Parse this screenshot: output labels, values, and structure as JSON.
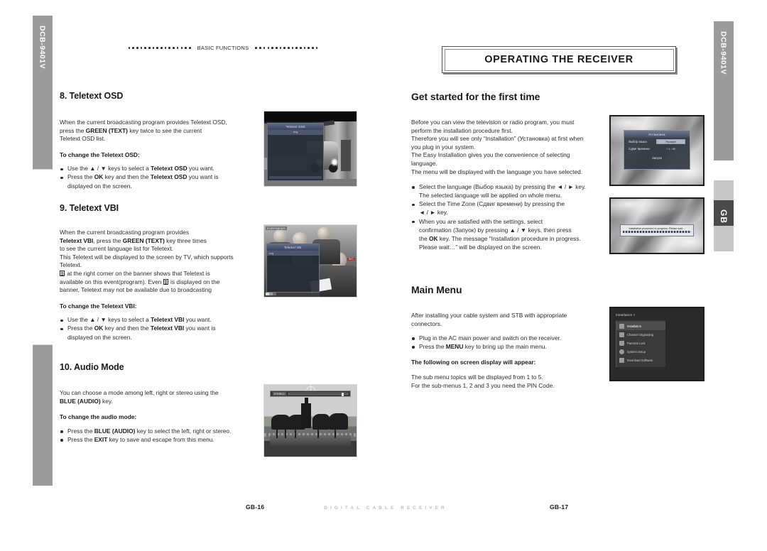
{
  "document": {
    "model": "DCB-9401V",
    "language_tab": "GB",
    "running_head": "BASIC FUNCTIONS",
    "running_head_dots": 16,
    "footer_brand": "DIGITAL CABLE RECEIVER"
  },
  "left_page": {
    "page_number": "GB-16",
    "sections": [
      {
        "heading": "8. Teletext OSD",
        "paragraph": "When the current broadcasting program provides Teletext OSD, press the GREEN (TEXT) key twice to see the current Teletext OSD list.",
        "para_parts": {
          "p1": "When the current broadcasting program provides Teletext OSD,",
          "p2a": "press the ",
          "p2b": "GREEN (TEXT)",
          "p2c": " key twice to see the current",
          "p3": "Teletext OSD list."
        },
        "sub_heading": "To change the Teletext OSD:",
        "bullets": [
          {
            "a": "Use the ▲ / ▼ keys to select a ",
            "b": "Teletext OSD",
            "c": " you want."
          },
          {
            "a": "Press the ",
            "b": "OK",
            "c": " key and then the ",
            "b2": "Teletext OSD",
            "c2": " you want is",
            "cont": "displayed on the screen."
          }
        ]
      },
      {
        "heading": "9. Teletext VBI",
        "para_parts": {
          "l1": "When the current broadcasting program provides",
          "l2a": "Teletext VBI",
          "l2b": ", press the ",
          "l2c": "GREEN (TEXT)",
          "l2d": " key three times",
          "l3": "to see the current language list for Teletext.",
          "l4": "This Teletext will be displayed to the screen by TV, which supports",
          "l5": "Teletext.",
          "l6": " at the right corner on the banner shows that Teletext is",
          "l7a": "available on this event(program). Even ",
          "l7b": " is displayed on the",
          "l8": "banner, Teletext may not be available due to broadcasting"
        },
        "sub_heading": "To change the Teletext VBI:",
        "bullets": [
          {
            "a": "Use the ▲ / ▼ keys to select a ",
            "b": "Teletext VBI",
            "c": " you want."
          },
          {
            "a": "Press the ",
            "b": "OK",
            "c": " key and then the ",
            "b2": "Teletext VBI",
            "c2": " you want is",
            "cont": "displayed on the screen."
          }
        ]
      },
      {
        "heading": "10. Audio Mode",
        "para_parts": {
          "l1": "You can choose a mode among left, right or stereo using the",
          "l2a": "BLUE (AUDIO)",
          "l2b": " key."
        },
        "sub_heading": "To change the audio mode:",
        "bullets": [
          {
            "a": "Press the ",
            "b": "BLUE (AUDIO)",
            "c": " key to select the left, right or stereo."
          },
          {
            "a": "Press the ",
            "b": "EXIT",
            "c": " key to save and escape from this menu."
          }
        ]
      }
    ],
    "figures": [
      {
        "name": "teletext-osd-screenshot",
        "osd_title": "Teletext OSD",
        "osd_row": "eng"
      },
      {
        "name": "teletext-vbi-screenshot",
        "osd_title": "Teletext VBI",
        "osd_row": "eng",
        "channel_tag": "EURONEWS",
        "corner_tag": "REC"
      },
      {
        "name": "audio-mode-screenshot",
        "bar_label": "STEREO"
      }
    ]
  },
  "right_page": {
    "page_number": "GB-17",
    "chapter_banner": "OPERATING THE RECEIVER",
    "sections": [
      {
        "heading": "Get started for the first time",
        "para_parts": {
          "l1": "Before you can view the television or radio program, you must",
          "l2": "perform the installation procedure first.",
          "l3": "Therefore you will see only “Installation” (Установка) at first when",
          "l4": "you plug in your system.",
          "l5": "The Easy Installation gives you the convenience of selecting",
          "l6": "language.",
          "l7": "The menu will be displayed with the language you have selected."
        },
        "bullets": [
          {
            "a": "Select the language (Выбор языка) by pressing the ◄ / ► key.",
            "cont": "The selected language will be applied on whole menu."
          },
          {
            "a": "Select the Time Zone (Сдвиг времени) by pressing the",
            "cont": "◄ / ► key."
          },
          {
            "a": "When you are satisfied with the settings, select",
            "cont": "confirmation (Запуок) by pressing ▲ / ▼ keys, then press",
            "cont2a": "the ",
            "cont2b": "OK",
            "cont2c": " key. The message “Installation procedure in progress.",
            "cont3": "Please wait…” will be displayed on the screen."
          }
        ]
      },
      {
        "heading": "Main Menu",
        "para_parts": {
          "l1": "After installing your cable system and STB with appropriate",
          "l2": "connectors."
        },
        "bullets": [
          {
            "a": "Plug in the AC main power and switch on the receiver."
          },
          {
            "a": "Press the ",
            "b": "MENU",
            "c": " key to bring up the main menu."
          }
        ],
        "sub_heading": "The following on screen display will appear:",
        "tail": {
          "l1": "The sub menu topics will be displayed from 1 to 5.",
          "l2": "For the sub-menus 1, 2 and 3 you need the PIN Code."
        }
      }
    ],
    "figures": [
      {
        "name": "easy-installation-screenshot",
        "dialog_title": "Установка",
        "rows": [
          {
            "key": "Выбор языка",
            "value": "Русский"
          },
          {
            "key": "Сдвиг времени",
            "value": "+ 1 : 00"
          }
        ],
        "confirm": "Запуск"
      },
      {
        "name": "installation-progress-screenshot",
        "toast": "Installation procedure in progress. Please wait…"
      },
      {
        "name": "main-menu-screenshot",
        "menu_title": "Installation >",
        "items": [
          "Installation",
          "Channel Organising",
          "Parental Lock",
          "System Setup",
          "Download Software"
        ]
      }
    ]
  }
}
